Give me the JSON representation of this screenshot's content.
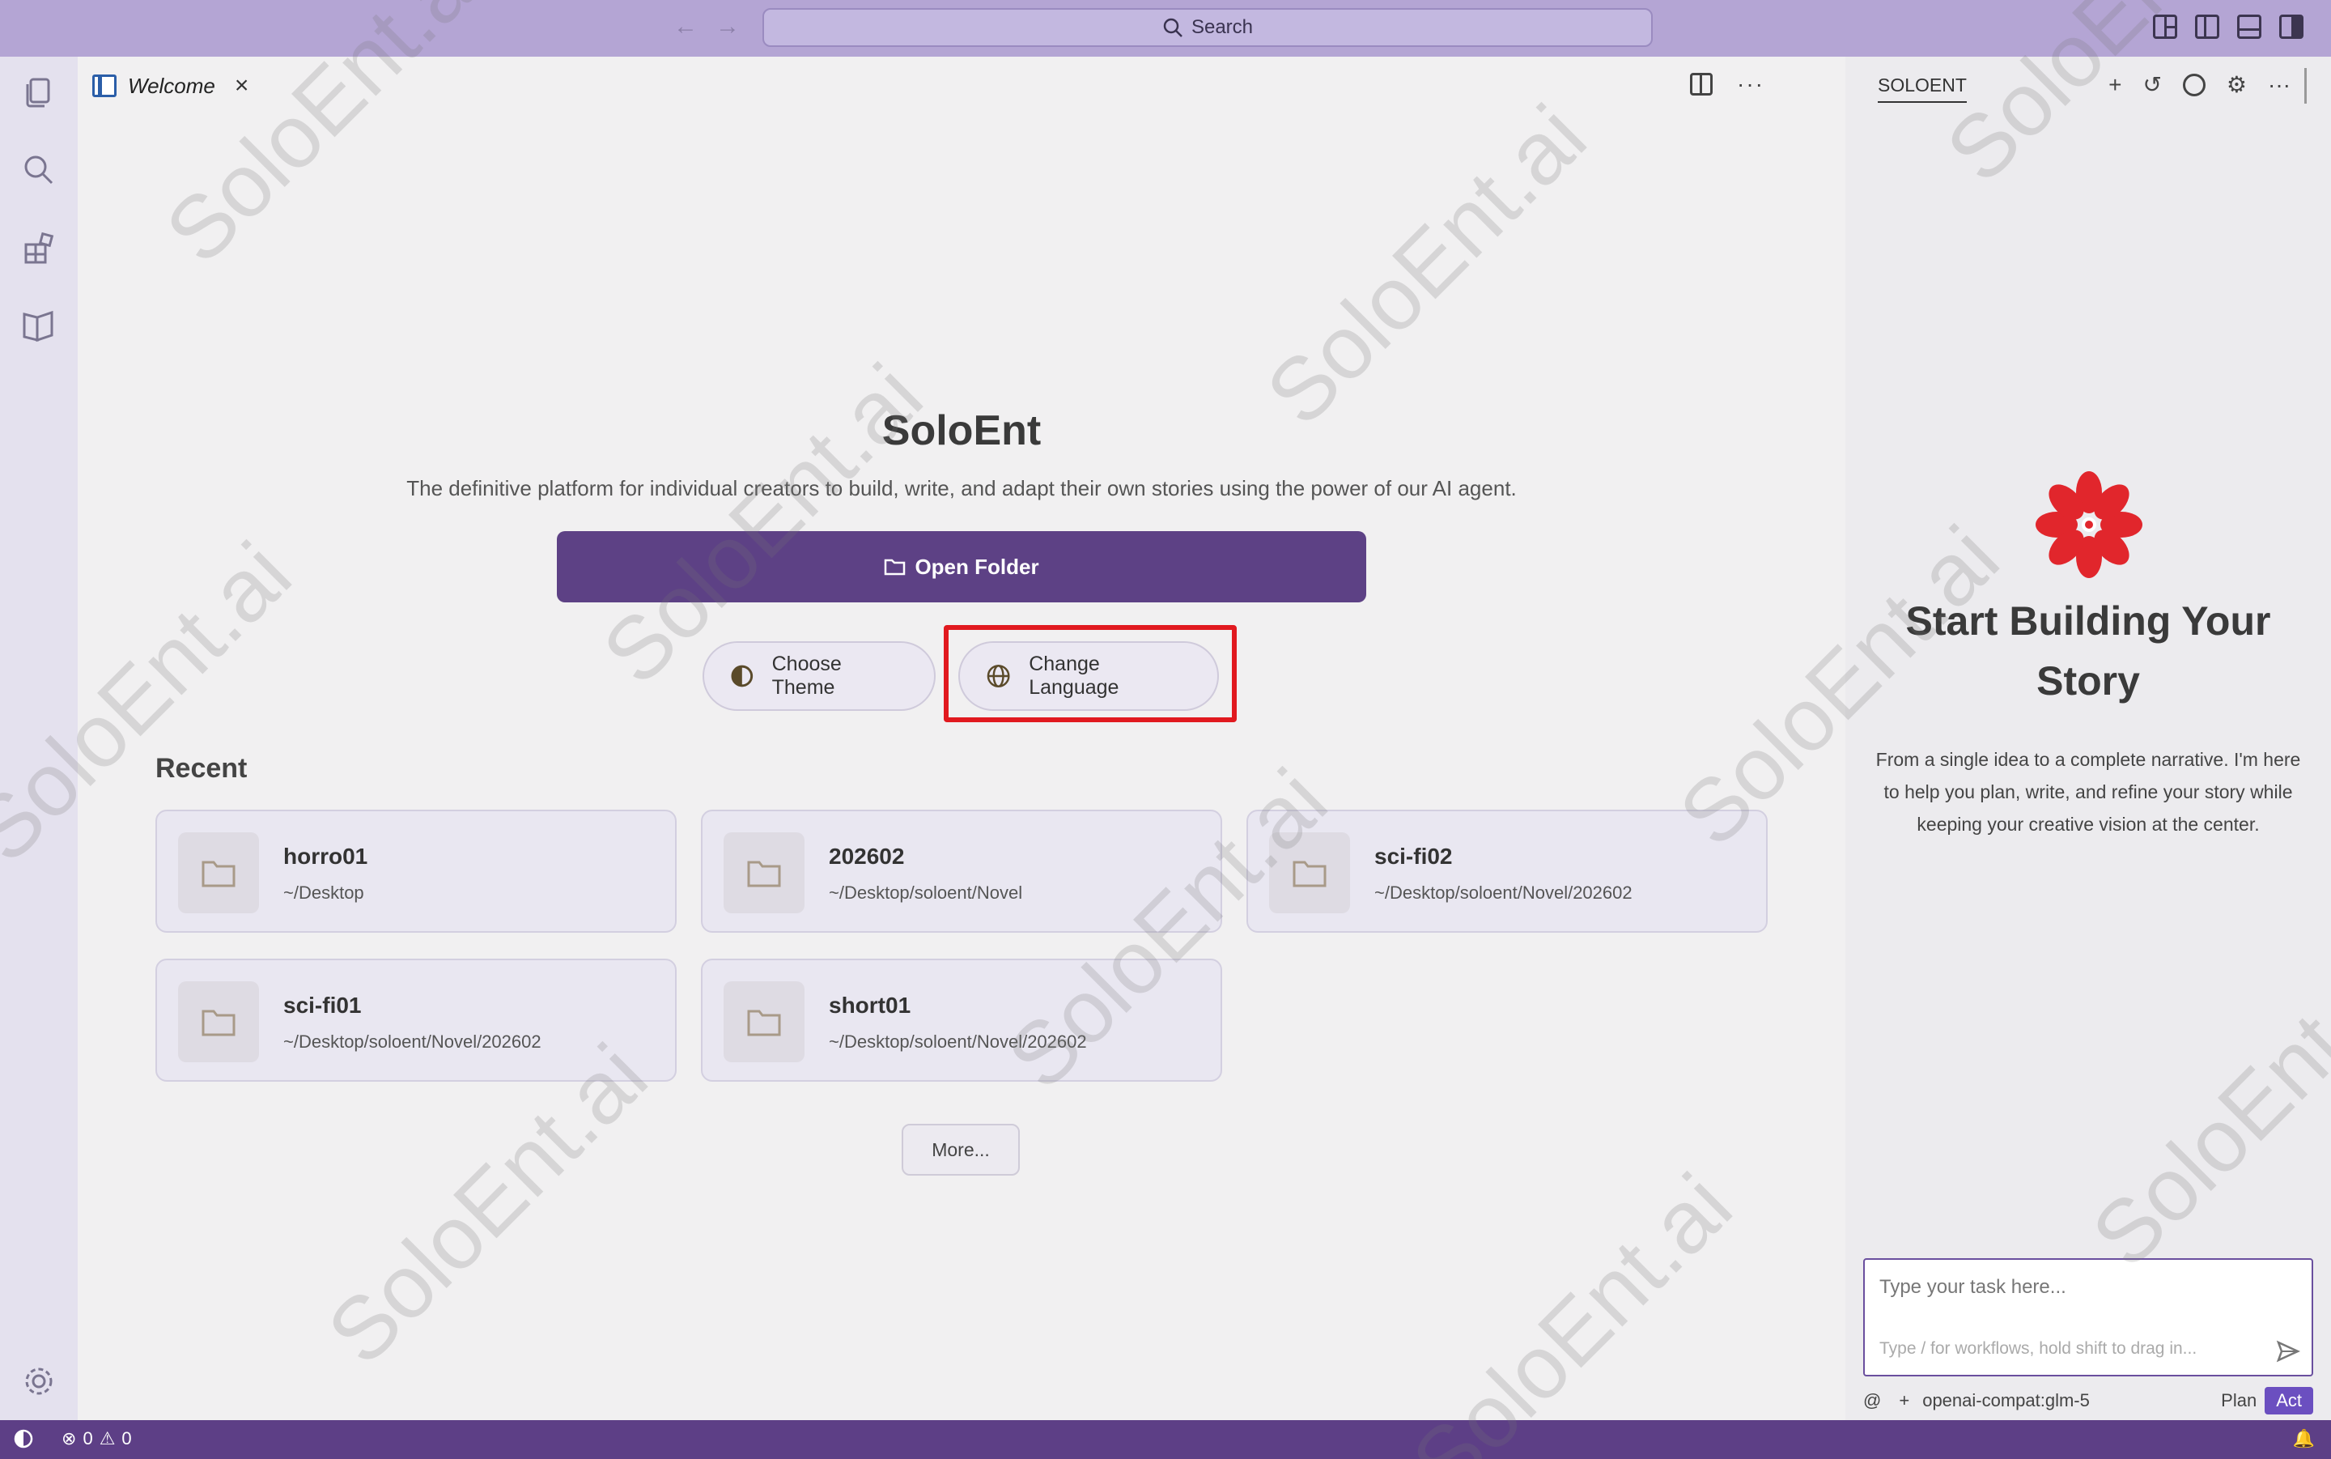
{
  "titlebar": {
    "search_placeholder": "Search",
    "back_icon": "arrow-left-icon",
    "forward_icon": "arrow-right-icon",
    "layout_icons": [
      "customize-layout-icon",
      "toggle-primary-sidebar-icon",
      "toggle-panel-icon",
      "toggle-secondary-sidebar-icon"
    ]
  },
  "activity_bar": {
    "items": [
      "explorer-icon",
      "search-icon",
      "extensions-icon",
      "book-icon"
    ],
    "settings_icon": "gear-icon"
  },
  "editor": {
    "tab": {
      "label": "Welcome",
      "close": "×"
    },
    "title": "SoloEnt",
    "subtitle": "The definitive platform for individual creators to build, write, and adapt their own stories using the power of our AI agent.",
    "open_folder_label": "Open Folder",
    "choose_theme_label": "Choose Theme",
    "change_language_label": "Change Language",
    "recent_heading": "Recent",
    "recent": [
      {
        "name": "horro01",
        "path": "~/Desktop"
      },
      {
        "name": "202602",
        "path": "~/Desktop/soloent/Novel"
      },
      {
        "name": "sci-fi02",
        "path": "~/Desktop/soloent/Novel/202602"
      },
      {
        "name": "sci-fi01",
        "path": "~/Desktop/soloent/Novel/202602"
      },
      {
        "name": "short01",
        "path": "~/Desktop/soloent/Novel/202602"
      }
    ],
    "more_label": "More..."
  },
  "panel": {
    "title": "SOLOENT",
    "heading": "Start Building Your Story",
    "description": "From a single idea to a complete narrative. I'm here to help you plan, write, and refine your story while keeping your creative vision at the center.",
    "task_placeholder": "Type your task here...",
    "task_hint": "Type / for workflows, hold shift to drag in...",
    "footer": {
      "at": "@",
      "plus": "+",
      "model": "openai-compat:glm-5",
      "plan": "Plan",
      "act": "Act"
    },
    "brand_color": "#e1262c"
  },
  "statusbar": {
    "errors": "0",
    "warnings": "0"
  },
  "colors": {
    "accent": "#5d4185",
    "titlebar": "#b4a5d4",
    "statusbar": "#5d3f86",
    "highlight": "#e1191f"
  },
  "watermark": "SoloEnt.ai"
}
